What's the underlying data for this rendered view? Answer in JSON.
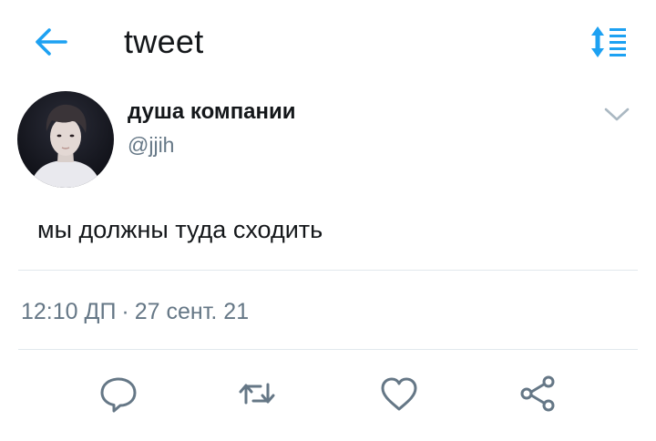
{
  "header": {
    "title": "tweet",
    "back_icon": "arrow-left-icon",
    "sort_icon": "sort-list-icon",
    "accent": "#1da1f2"
  },
  "tweet": {
    "author": {
      "display_name": "душа компании",
      "handle": "@jjih",
      "avatar_icon": "avatar-photo"
    },
    "text": "мы должны туда сходить",
    "time": "12:10 ДП",
    "separator": "·",
    "date": "27 сент. 21",
    "menu_icon": "chevron-down-icon"
  },
  "actions": [
    {
      "name": "reply",
      "icon": "comment-icon"
    },
    {
      "name": "retweet",
      "icon": "retweet-icon"
    },
    {
      "name": "like",
      "icon": "heart-icon"
    },
    {
      "name": "share",
      "icon": "share-icon"
    }
  ],
  "colors": {
    "text": "#14171a",
    "secondary": "#657786",
    "divider": "#e1e8ed",
    "accent": "#1da1f2"
  }
}
